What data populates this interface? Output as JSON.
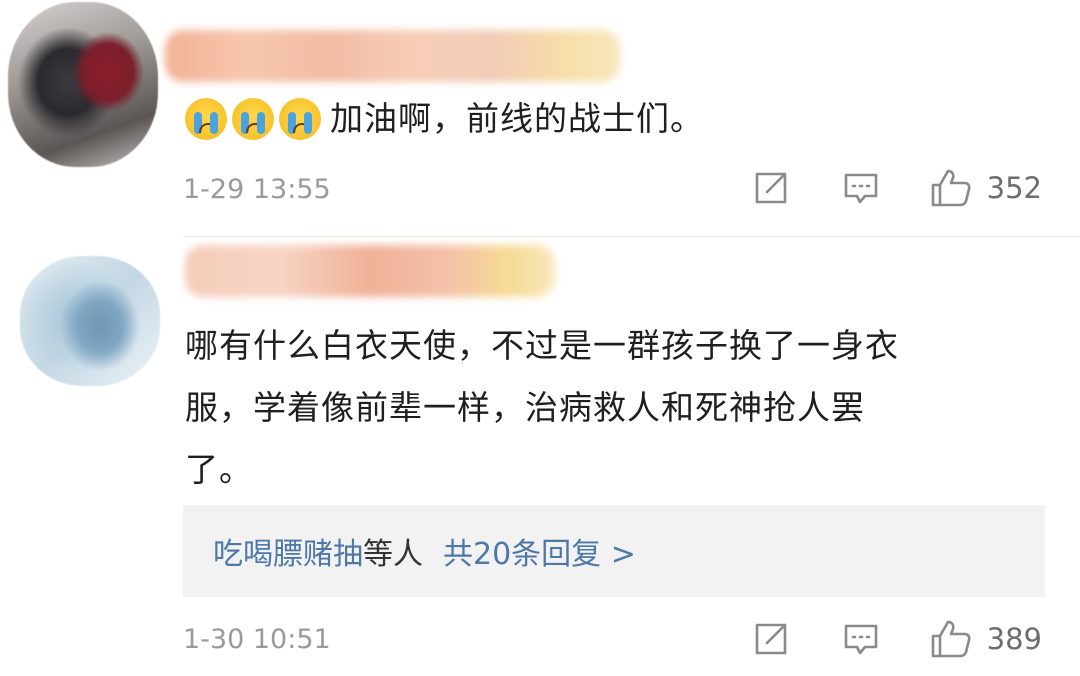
{
  "comments": [
    {
      "emojis": [
        "crying-face",
        "crying-face",
        "crying-face"
      ],
      "text": "加油啊，前线的战士们。",
      "time": "1-29 13:55",
      "likes": "352"
    },
    {
      "text_lines": [
        "哪有什么白衣天使，不过是一群孩子换了一身衣",
        "服，学着像前辈一样，治病救人和死神抢人罢",
        "了。"
      ],
      "replies": {
        "names": "吃喝膘赌抽",
        "etc": "等人",
        "total": "共20条回复 >"
      },
      "time": "1-30 10:51",
      "likes": "389"
    }
  ],
  "icons": {
    "share": "share-icon",
    "reply": "comment-icon",
    "like": "thumbs-up-icon"
  },
  "colors": {
    "link": "#4d78a8",
    "meta": "#9a9a9a",
    "reply_box_bg": "#f2f2f2"
  }
}
